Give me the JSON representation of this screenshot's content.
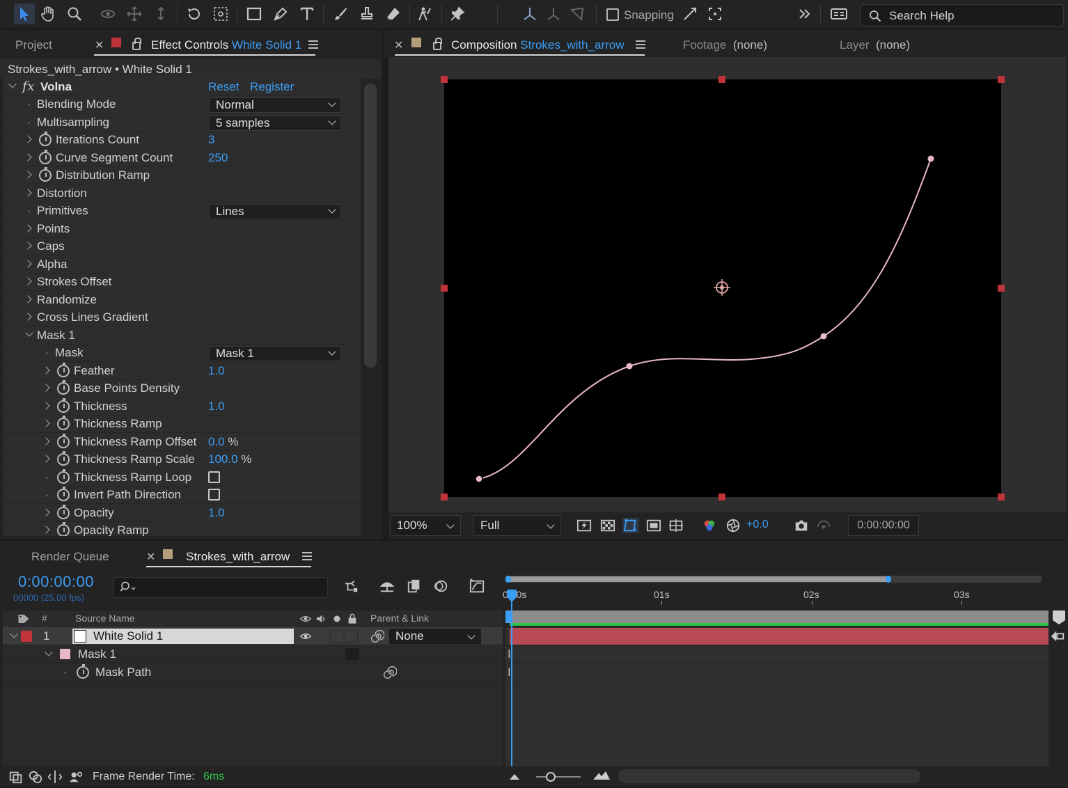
{
  "toolbar": {
    "snapping_label": "Snapping",
    "search_help_label": "Search Help"
  },
  "effect_controls": {
    "tab_project": "Project",
    "tab_label": "Effect Controls",
    "tab_layer": "White Solid 1",
    "breadcrumb": "Strokes_with_arrow • White Solid 1",
    "effect_name": "Volna",
    "reset_label": "Reset",
    "register_label": "Register",
    "rows": {
      "blending_mode": {
        "label": "Blending Mode",
        "value": "Normal"
      },
      "multisampling": {
        "label": "Multisampling",
        "value": "5 samples"
      },
      "iterations_count": {
        "label": "Iterations Count",
        "value": "3"
      },
      "curve_segment_count": {
        "label": "Curve Segment Count",
        "value": "250"
      },
      "distribution_ramp": {
        "label": "Distribution Ramp"
      },
      "distortion": {
        "label": "Distortion"
      },
      "primitives": {
        "label": "Primitives",
        "value": "Lines"
      },
      "points": {
        "label": "Points"
      },
      "caps": {
        "label": "Caps"
      },
      "alpha": {
        "label": "Alpha"
      },
      "strokes_offset": {
        "label": "Strokes Offset"
      },
      "randomize": {
        "label": "Randomize"
      },
      "cross_lines_gradient": {
        "label": "Cross Lines Gradient"
      },
      "mask_1": {
        "label": "Mask 1"
      },
      "mask": {
        "label": "Mask",
        "value": "Mask 1"
      },
      "feather": {
        "label": "Feather",
        "value": "1.0"
      },
      "base_points_density": {
        "label": "Base Points Density"
      },
      "thickness": {
        "label": "Thickness",
        "value": "1.0"
      },
      "thickness_ramp": {
        "label": "Thickness Ramp"
      },
      "thickness_ramp_offset": {
        "label": "Thickness Ramp Offset",
        "value": "0.0",
        "unit": "%"
      },
      "thickness_ramp_scale": {
        "label": "Thickness Ramp Scale",
        "value": "100.0",
        "unit": "%"
      },
      "thickness_ramp_loop": {
        "label": "Thickness Ramp Loop",
        "checked": false
      },
      "invert_path_direction": {
        "label": "Invert Path Direction",
        "checked": false
      },
      "opacity": {
        "label": "Opacity",
        "value": "1.0"
      },
      "opacity_ramp": {
        "label": "Opacity Ramp"
      }
    }
  },
  "composition": {
    "tab_label": "Composition",
    "tab_name": "Strokes_with_arrow",
    "footage_label": "Footage",
    "footage_value": "(none)",
    "layer_label": "Layer",
    "layer_value": "(none)",
    "zoom": "100%",
    "resolution": "Full",
    "exposure": "+0.0",
    "timecode": "0:00:00:00"
  },
  "timeline": {
    "tab_render_queue": "Render Queue",
    "tab_comp": "Strokes_with_arrow",
    "current_time": "0:00:00:00",
    "frame_info": "00000 (25.00 fps)",
    "col_number": "#",
    "col_source_name": "Source Name",
    "col_parent": "Parent & Link",
    "ruler_labels": [
      "0:00s",
      "01s",
      "02s",
      "03s"
    ],
    "layer": {
      "number": "1",
      "name": "White Solid 1",
      "parent": "None"
    },
    "mask_label": "Mask 1",
    "mask_path_label": "Mask Path",
    "frame_render_label": "Frame Render Time:",
    "frame_render_value": "6ms"
  },
  "colors": {
    "accent": "#3b9ef5",
    "layer_label": "#c0333a",
    "mask_color": "#e8b9c9",
    "track_bar": "#b74a55",
    "work_area": "#2ec24b"
  }
}
